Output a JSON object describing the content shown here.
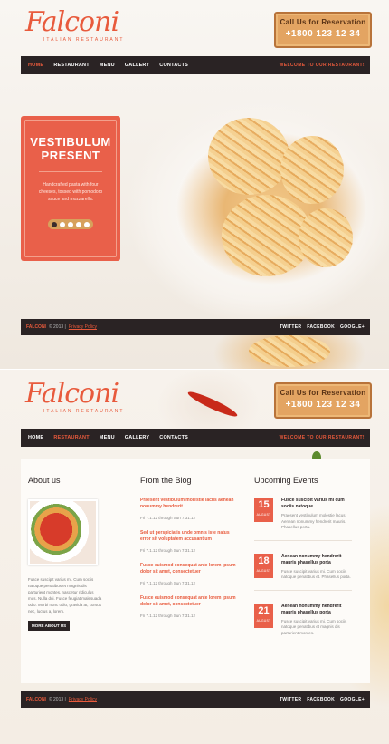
{
  "brand": {
    "name": "Falconi",
    "tagline": "ITALIAN RESTAURANT"
  },
  "reservation": {
    "label": "Call Us for Reservation",
    "phone": "+1800 123 12 34"
  },
  "nav": {
    "items": [
      "HOME",
      "RESTAURANT",
      "MENU",
      "GALLERY",
      "CONTACTS"
    ],
    "welcome": "WELCOME TO OUR RESTAURANT!"
  },
  "hero": {
    "title_line1": "VESTIBULUM",
    "title_line2": "PRESENT",
    "text": "Handcrafted pasta with four cheeses, tossed with pomodoro sauce and mozzarella.",
    "slides": 5,
    "active_slide": 1
  },
  "footer": {
    "brand": "FALCONI",
    "copy": "© 2013 |",
    "privacy": "Privacy Policy",
    "social": [
      "TWITTER",
      "FACEBOOK",
      "GOOGLE+"
    ]
  },
  "about": {
    "heading": "About us",
    "text": "Fusce suscipit varius mi. Cum sociis natoque penatibus et magnis dis parturient montes, nascetur ridiculus mus. Nulla dui. Fusce feugiat malesuada odio. Morbi nunc odio, gravida at, cursus nec, luctus a, lorem.",
    "button": "MORE ABOUT US"
  },
  "blog": {
    "heading": "From the Blog",
    "posts": [
      {
        "title": "Praesent vestibulum molestie lacus aenean nonummy hendrerit",
        "meta": "Fri 7.1.12 through Sun 7.31.12"
      },
      {
        "title": "Sed ut perspiciatis unde omnis iste natus error sit voluptatem accusantium",
        "meta": "Fri 7.1.12 through Sun 7.31.12"
      },
      {
        "title": "Fusce euismod consequat ante lorem ipsum dolor sit amet, consectetuer",
        "meta": "Fri 7.1.12 through Sun 7.31.12"
      },
      {
        "title": "Fusce euismod consequat ante lorem ipsum dolor sit amet, consectetuer",
        "meta": "Fri 7.1.12 through Sun 7.31.12"
      }
    ]
  },
  "events": {
    "heading": "Upcoming Events",
    "items": [
      {
        "day": "15",
        "month": "AUGUST",
        "title": "Fusce suscipit varius mi cum sociis natoque",
        "text": "Praesent vestibulum molestie lacus. Aenean nonummy hendrerit mauris. Phasellus porta."
      },
      {
        "day": "18",
        "month": "AUGUST",
        "title": "Aenean nonummy hendrerit mauris phasellus porta",
        "text": "Fusce suscipit varius mi. Cum sociis natoque penatibus et. Phasellus porta."
      },
      {
        "day": "21",
        "month": "AUGUST",
        "title": "Aenean nonummy hendrerit mauris phasellus porta",
        "text": "Fusce suscipit varius mi. Cum sociis natoque penatibus et magnis dis parturient montes."
      }
    ]
  },
  "colors": {
    "accent": "#e85a3c",
    "dark": "#2a2324",
    "wood": "#e3a462"
  }
}
